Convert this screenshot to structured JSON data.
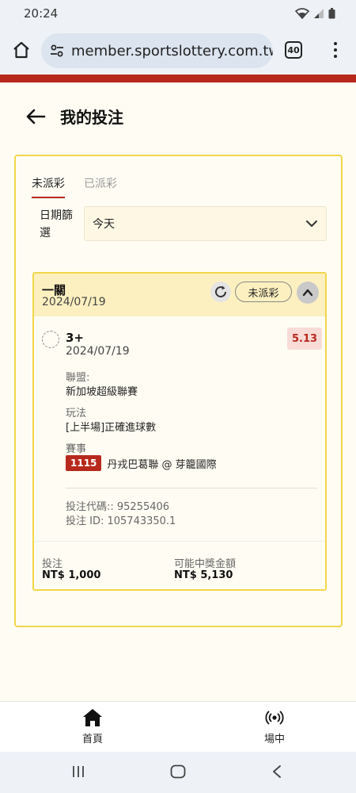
{
  "status_bar": {
    "time": "20:24"
  },
  "browser": {
    "url": "member.sportslottery.com.tw",
    "tab_count": "40"
  },
  "page": {
    "title": "我的投注"
  },
  "tabs": [
    {
      "label": "未派彩",
      "active": true
    },
    {
      "label": "已派彩",
      "active": false
    }
  ],
  "filter": {
    "label": "日期篩選",
    "value": "今天"
  },
  "bet": {
    "type": "一關",
    "date": "2024/07/19",
    "status": "未派彩",
    "selection": "3+",
    "selection_date": "2024/07/19",
    "odds": "5.13",
    "league_label": "聯盟:",
    "league": "新加坡超級聯賽",
    "market_label": "玩法",
    "market": "[上半場]正確進球數",
    "event_label": "賽事",
    "match_id": "1115",
    "match": "丹戎巴葛聯 @ 芽籠國際",
    "ticket_code": "投注代碼:: 95255406",
    "ticket_id": "投注 ID: 105743350.1",
    "stake_label": "投注",
    "stake": "NT$ 1,000",
    "payout_label": "可能中獎金額",
    "payout": "NT$ 5,130"
  },
  "bottom_nav": [
    {
      "label": "首頁",
      "icon": "home-icon"
    },
    {
      "label": "場中",
      "icon": "live-broadcast-icon"
    }
  ],
  "colors": {
    "accent": "#b8291d",
    "border_yellow": "#f2d64b",
    "header_bg": "#fdf0c0"
  }
}
